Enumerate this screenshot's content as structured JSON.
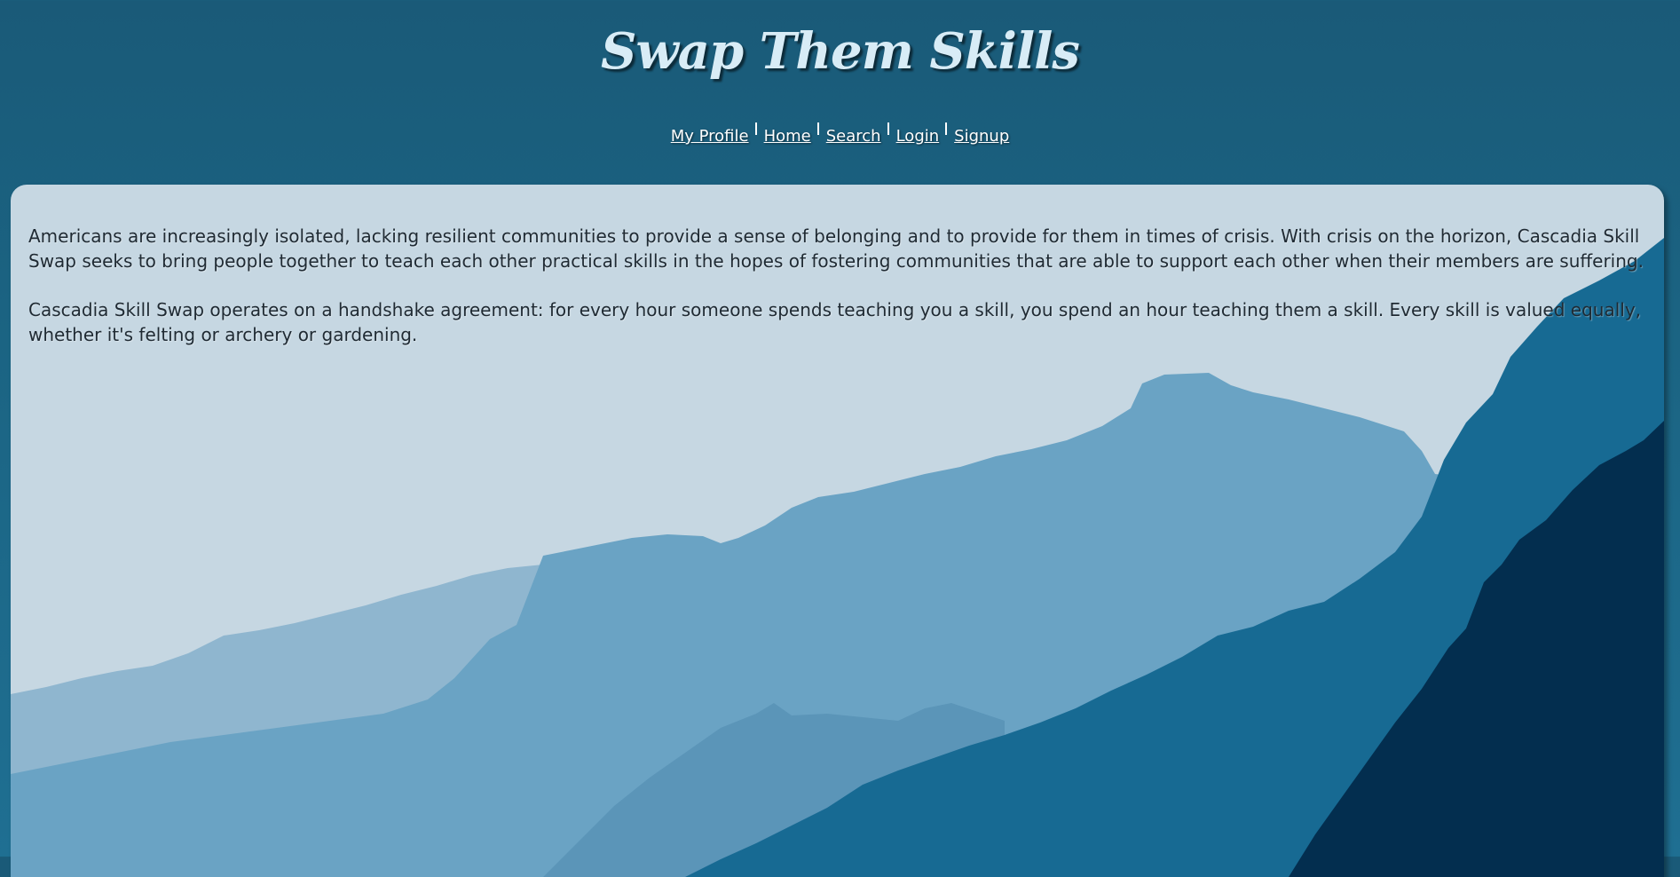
{
  "header": {
    "title": "Swap Them Skills"
  },
  "nav": {
    "items": [
      {
        "label": "My Profile"
      },
      {
        "label": "Home"
      },
      {
        "label": "Search"
      },
      {
        "label": "Login"
      },
      {
        "label": "Signup"
      }
    ]
  },
  "main": {
    "paragraphs": [
      "Americans are increasingly isolated, lacking resilient communities to provide a sense of belonging and to provide for them in times of crisis. With crisis on the horizon, Cascadia Skill Swap seeks to bring people together to teach each other practical skills in the hopes of fostering communities that are able to support each other when their members are suffering.",
      "Cascadia Skill Swap operates on a handshake agreement: for every hour someone spends teaching you a skill, you spend an hour teaching them a skill. Every skill is valued equally, whether it's felting or archery or gardening."
    ]
  },
  "colors": {
    "page_background": "#1b6483",
    "panel_sky": "#c6d7e2",
    "far_ridge": "#8fb6cf",
    "mid_ridge": "#6aa3c4",
    "near_ridge": "#176a93",
    "front_ridge": "#032e4f",
    "title_text": "#d8ecf6",
    "body_text": "#1f2a33"
  }
}
